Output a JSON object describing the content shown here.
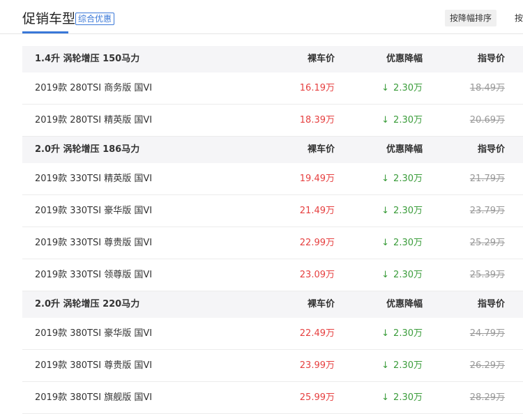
{
  "header": {
    "title": "促销车型",
    "tag": "综合优惠",
    "sort_button": "按降幅排序",
    "sort_button_2": "按"
  },
  "colors": {
    "accent": "#3a78d8",
    "price": "#e64040",
    "discount": "#3a9c3a",
    "guide": "#999999"
  },
  "icons": {
    "discount_arrow": "arrow-down-icon"
  },
  "groups": [
    {
      "engine": "1.4升 涡轮增压 150马力",
      "col_price": "裸车价",
      "col_discount": "优惠降幅",
      "col_guide": "指导价",
      "rows": [
        {
          "name": "2019款 280TSI 商务版 国VI",
          "price": "16.19万",
          "discount": "2.30万",
          "guide": "18.49万"
        },
        {
          "name": "2019款 280TSI 精英版 国VI",
          "price": "18.39万",
          "discount": "2.30万",
          "guide": "20.69万"
        }
      ]
    },
    {
      "engine": "2.0升 涡轮增压 186马力",
      "col_price": "裸车价",
      "col_discount": "优惠降幅",
      "col_guide": "指导价",
      "rows": [
        {
          "name": "2019款 330TSI 精英版 国VI",
          "price": "19.49万",
          "discount": "2.30万",
          "guide": "21.79万"
        },
        {
          "name": "2019款 330TSI 豪华版 国VI",
          "price": "21.49万",
          "discount": "2.30万",
          "guide": "23.79万"
        },
        {
          "name": "2019款 330TSI 尊贵版 国VI",
          "price": "22.99万",
          "discount": "2.30万",
          "guide": "25.29万"
        },
        {
          "name": "2019款 330TSI 领尊版 国VI",
          "price": "23.09万",
          "discount": "2.30万",
          "guide": "25.39万"
        }
      ]
    },
    {
      "engine": "2.0升 涡轮增压 220马力",
      "col_price": "裸车价",
      "col_discount": "优惠降幅",
      "col_guide": "指导价",
      "rows": [
        {
          "name": "2019款 380TSI 豪华版 国VI",
          "price": "22.49万",
          "discount": "2.30万",
          "guide": "24.79万"
        },
        {
          "name": "2019款 380TSI 尊贵版 国VI",
          "price": "23.99万",
          "discount": "2.30万",
          "guide": "26.29万"
        },
        {
          "name": "2019款 380TSI 旗舰版 国VI",
          "price": "25.99万",
          "discount": "2.30万",
          "guide": "28.29万"
        }
      ]
    }
  ]
}
